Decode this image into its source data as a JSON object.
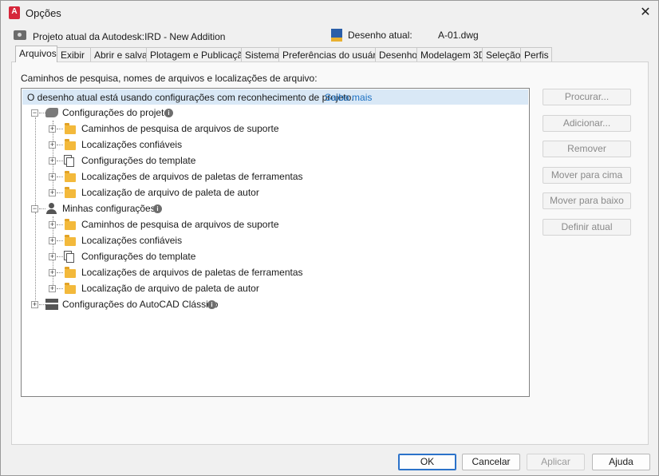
{
  "window": {
    "title": "Opções",
    "app_icon_letter": "A"
  },
  "info": {
    "project_label": "Projeto atual da Autodesk:IRD - New Addition",
    "drawing_label": "Desenho atual:",
    "drawing_value": "A-01.dwg"
  },
  "tabs": [
    {
      "label": "Arquivos",
      "active": true
    },
    {
      "label": "Exibir"
    },
    {
      "label": "Abrir e salvar"
    },
    {
      "label": "Plotagem e Publicação"
    },
    {
      "label": "Sistema"
    },
    {
      "label": "Preferências do usuário"
    },
    {
      "label": "Desenho"
    },
    {
      "label": "Modelagem 3D"
    },
    {
      "label": "Seleção"
    },
    {
      "label": "Perfis"
    }
  ],
  "panel": {
    "caption": "Caminhos de pesquisa, nomes de arquivos e localizações de arquivo:",
    "banner_text": "O desenho atual está usando configurações com reconhecimento de projeto.",
    "banner_link": "Saiba mais"
  },
  "tree": {
    "project": {
      "label": "Configurações do projeto",
      "icon": "project-settings-icon",
      "children": [
        {
          "label": "Caminhos de pesquisa de arquivos de suporte",
          "icon": "folder-icon"
        },
        {
          "label": "Localizações confiáveis",
          "icon": "folder-icon"
        },
        {
          "label": "Configurações do template",
          "icon": "template-icon"
        },
        {
          "label": "Localizações de arquivos de paletas de ferramentas",
          "icon": "folder-icon"
        },
        {
          "label": "Localização de arquivo de paleta de autor",
          "icon": "folder-icon"
        }
      ]
    },
    "mine": {
      "label": "Minhas configurações",
      "icon": "user-icon",
      "children": [
        {
          "label": "Caminhos de pesquisa de arquivos de suporte",
          "icon": "folder-icon"
        },
        {
          "label": "Localizações confiáveis",
          "icon": "folder-icon"
        },
        {
          "label": "Configurações do template",
          "icon": "template-icon"
        },
        {
          "label": "Localizações de arquivos de paletas de ferramentas",
          "icon": "folder-icon"
        },
        {
          "label": "Localização de arquivo de paleta de autor",
          "icon": "folder-icon"
        }
      ]
    },
    "classic": {
      "label": "Configurações do AutoCAD Clássico",
      "icon": "classic-settings-icon"
    }
  },
  "side_buttons": {
    "browse": "Procurar...",
    "add": "Adicionar...",
    "remove": "Remover",
    "move_up": "Mover para cima",
    "move_down": "Mover para baixo",
    "set_current": "Definir atual"
  },
  "footer": {
    "ok": "OK",
    "cancel": "Cancelar",
    "apply": "Aplicar",
    "help": "Ajuda"
  },
  "colors": {
    "banner_bg": "#d9e8f6",
    "link": "#1a6fc2",
    "folder": "#f3b93b",
    "primary_border": "#2b72c9"
  }
}
